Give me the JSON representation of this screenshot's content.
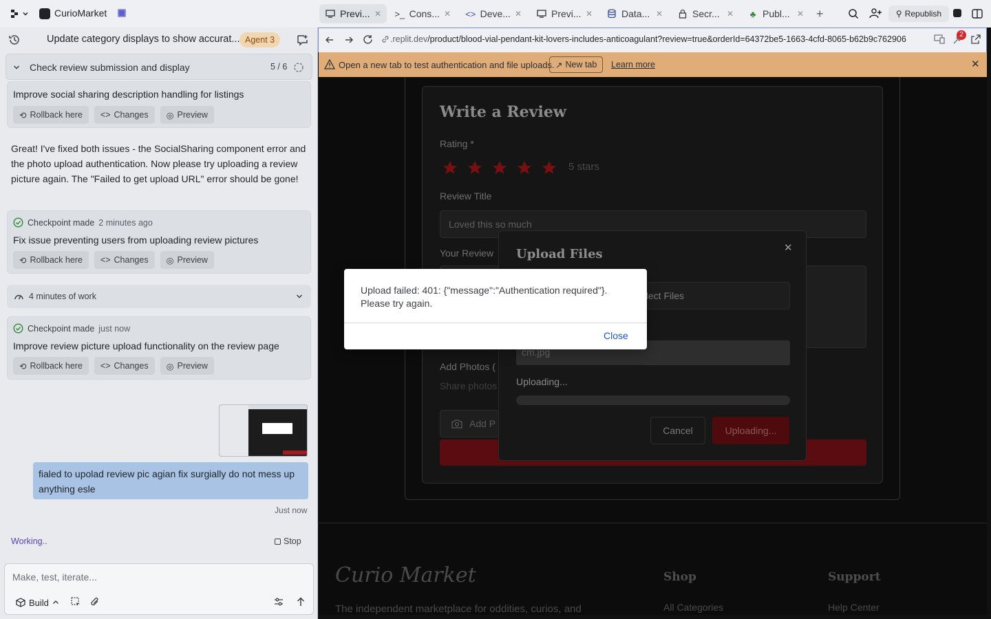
{
  "app": {
    "name": "CurioMarket"
  },
  "tabs": [
    {
      "label": "Previ...",
      "icon": "preview-icon",
      "active": true
    },
    {
      "label": "Cons...",
      "icon": "console-icon"
    },
    {
      "label": "Deve...",
      "icon": "code-icon"
    },
    {
      "label": "Previ...",
      "icon": "preview-icon"
    },
    {
      "label": "Data...",
      "icon": "database-icon"
    },
    {
      "label": "Secr...",
      "icon": "lock-icon"
    },
    {
      "label": "Publ...",
      "icon": "publish-icon"
    }
  ],
  "toolbar": {
    "republish_label": "Republish"
  },
  "agent": {
    "header_title": "Update category displays to show accurat...",
    "badge": "Agent 3",
    "task_label": "Check review submission and display",
    "task_count": "5 / 6",
    "card1_title": "Improve social sharing description handling for listings",
    "btn_rollback": "Rollback here",
    "btn_changes": "Changes",
    "btn_preview": "Preview",
    "message": "Great! I've fixed both issues - the SocialSharing component error and the photo upload authentication. Now please try uploading a review picture again. The \"Failed to get upload URL\" error should be gone!",
    "checkpoint2_label": "Checkpoint made",
    "checkpoint2_ago": "2 minutes ago",
    "card2_title": "Fix issue preventing users from uploading review pictures",
    "worklog": "4 minutes of work",
    "checkpoint3_label": "Checkpoint made",
    "checkpoint3_ago": "just now",
    "card3_title": "Improve review picture upload functionality on the review page",
    "user_message": "fialed to upolad review pic agian fix surgially do not mess up anything esle",
    "user_time": "Just now",
    "status": "Working..",
    "stop_label": "Stop",
    "input_placeholder": "Make, test, iterate...",
    "build_label": "Build"
  },
  "browser": {
    "url_domain": ".replit.dev",
    "url_path": "/product/blood-vial-pendant-kit-lovers-includes-anticoagulant?review=true&orderId=64372be5-1663-4cfd-8065-b62b9c762906",
    "notif_count": "2",
    "warning_text": "Open a new tab to test authentication and file uploads.",
    "new_tab_label": "New tab",
    "learn_more": "Learn more"
  },
  "review_form": {
    "title": "Write a Review",
    "rating_label": "Rating *",
    "rating_text": "5 stars",
    "rating_value": 5,
    "review_title_label": "Review Title",
    "review_title_value": "Loved this so much",
    "your_review_label": "Your Review",
    "add_photos_label": "Add Photos (",
    "add_photos_hint": "Share photos",
    "add_photo_button": "Add P"
  },
  "upload_dialog": {
    "title": "Upload Files",
    "select_files": "elect Files",
    "file_name": "cm.jpg",
    "status": "Uploading...",
    "cancel": "Cancel",
    "uploading_button": "Uploading..."
  },
  "footer": {
    "logo": "Curio Market",
    "tagline": "The independent marketplace for oddities, curios, and",
    "shop_heading": "Shop",
    "shop_link": "All Categories",
    "support_heading": "Support",
    "support_link": "Help Center"
  },
  "alert": {
    "message": "Upload failed: 401: {\"message\":\"Authentication required\"}. Please try again.",
    "close": "Close"
  },
  "colors": {
    "accent": "#1a55c9",
    "star": "#7a0f12",
    "warning": "#e0ac77",
    "user_bubble": "#a9c3e4"
  }
}
